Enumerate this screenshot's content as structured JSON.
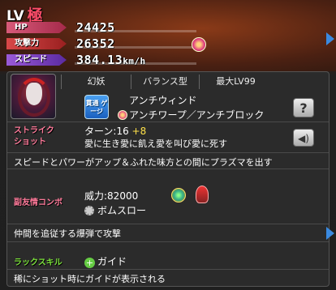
{
  "header": {
    "level_label": "LV",
    "level_value": "極"
  },
  "stats": {
    "hp_label": "HP",
    "hp_value": "24425",
    "atk_label": "攻撃力",
    "atk_value": "26352",
    "spd_label": "スピード",
    "spd_value": "384.13",
    "spd_unit": "km/h"
  },
  "monster": {
    "tribe": "幻妖",
    "type": "バランス型",
    "max_level": "最大LV99"
  },
  "abilities": {
    "icon_text": "貫通 ゲージ",
    "ability_1": "アンチウィンド",
    "ability_2": "アンチワープ／アンチブロック"
  },
  "strike_shot": {
    "label": "ストライク ショット",
    "turn_label": "ターン:16",
    "turn_bonus": "+8",
    "name": "愛に生き愛に飢え愛を叫び愛に死す",
    "description": "スピードとパワーがアップ＆ふれた味方との間にプラズマを出す"
  },
  "combo": {
    "label": "副友情コンボ",
    "power": "威力:82000",
    "name": "ボムスロー",
    "description": "仲間を追従する爆弾で攻撃"
  },
  "luck_skill": {
    "label": "ラックスキル",
    "name": "ガイド",
    "description": "稀にショット時にガイドが表示される"
  },
  "icons": {
    "help": "?",
    "sound": "speaker-icon"
  }
}
